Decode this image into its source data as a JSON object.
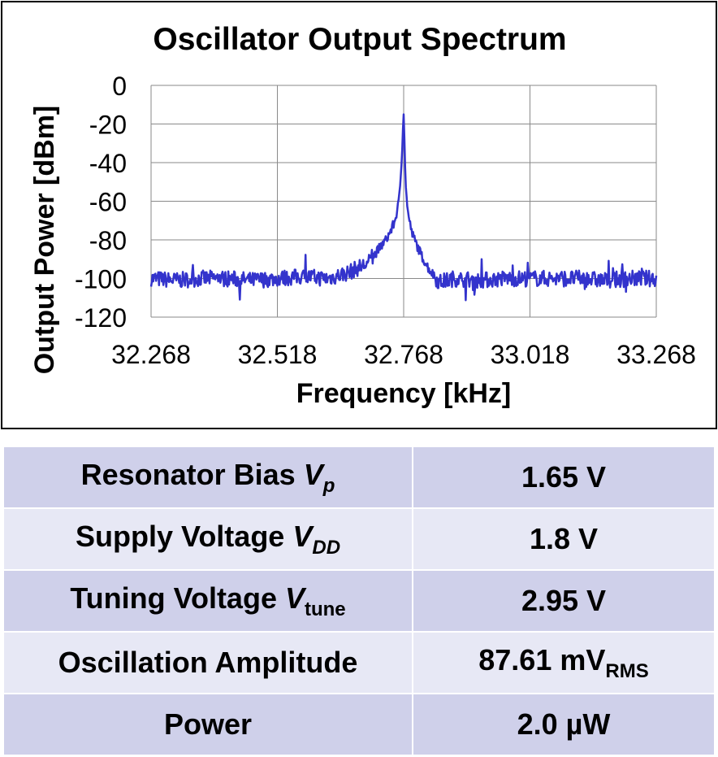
{
  "chart_data": {
    "type": "line",
    "title": "Oscillator Output Spectrum",
    "xlabel": "Frequency [kHz]",
    "ylabel": "Output Power [dBm]",
    "xlim": [
      32.268,
      33.268
    ],
    "ylim": [
      -120,
      0
    ],
    "x_ticks": [
      "32.268",
      "32.518",
      "32.768",
      "33.018",
      "33.268"
    ],
    "y_ticks": [
      "0",
      "-20",
      "-40",
      "-60",
      "-80",
      "-100",
      "-120"
    ],
    "grid": true,
    "legend": "none",
    "line_color": "#3333cc",
    "series": [
      {
        "x": [
          32.268,
          32.318,
          32.368,
          32.418,
          32.468,
          32.518,
          32.568,
          32.618,
          32.658,
          32.698,
          32.718,
          32.733,
          32.743,
          32.751,
          32.757,
          32.761,
          32.764,
          32.766,
          32.767,
          32.768,
          32.769,
          32.77,
          32.772,
          32.775,
          32.779,
          32.785,
          32.793,
          32.803,
          32.818,
          32.838,
          32.868,
          32.918,
          32.968,
          33.018,
          33.068,
          33.118,
          33.168,
          33.218,
          33.268
        ],
        "values": [
          -100,
          -101,
          -100,
          -100,
          -101,
          -100,
          -99,
          -100,
          -97,
          -92,
          -85,
          -80,
          -75,
          -70,
          -62,
          -52,
          -40,
          -28,
          -18,
          -15,
          -22,
          -35,
          -52,
          -62,
          -70,
          -77,
          -82,
          -88,
          -95,
          -102,
          -100,
          -101,
          -100,
          -100,
          -100,
          -100,
          -101,
          -100,
          -100
        ]
      }
    ]
  },
  "table": {
    "rows": [
      {
        "label": "Resonator Bias ",
        "sym": "V",
        "sub": "p",
        "value": "1.65 V",
        "value_sub": ""
      },
      {
        "label": "Supply Voltage ",
        "sym": "V",
        "sub": "DD",
        "value": "1.8 V",
        "value_sub": ""
      },
      {
        "label": "Tuning Voltage ",
        "sym": "V",
        "sub": "tune",
        "value": "2.95 V",
        "value_sub": ""
      },
      {
        "label": "Oscillation Amplitude",
        "sym": "",
        "sub": "",
        "value": "87.61 mV",
        "value_sub": "RMS"
      },
      {
        "label": "Power",
        "sym": "",
        "sub": "",
        "value": "2.0 µW",
        "value_sub": ""
      }
    ]
  }
}
